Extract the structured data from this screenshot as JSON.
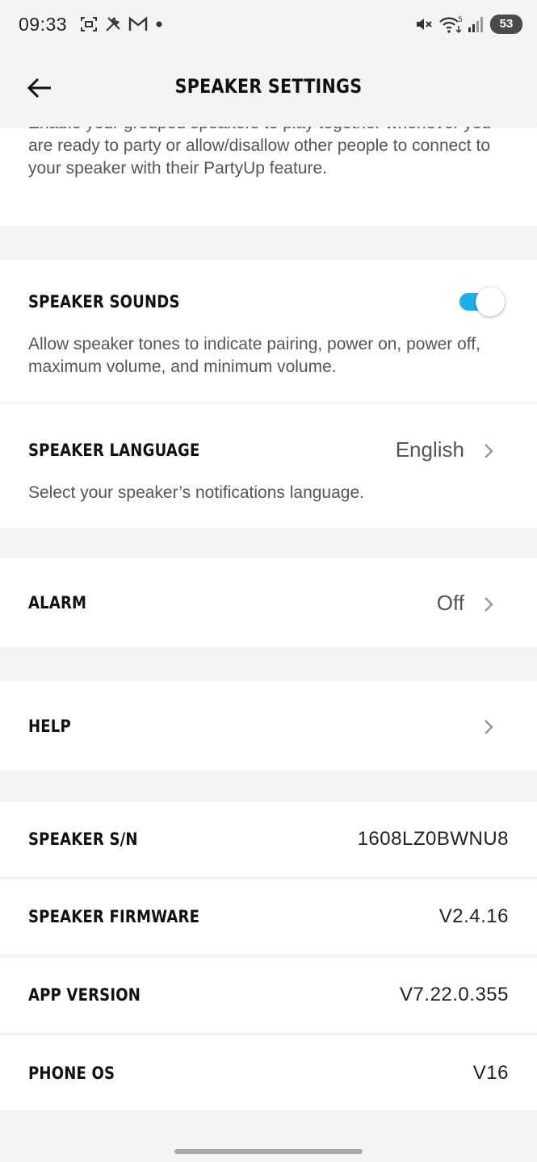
{
  "status_bar": {
    "time": "09:33",
    "battery": "53",
    "left_icons": [
      "screenshot-icon",
      "tools-icon",
      "gmail-icon",
      "notification-dot-icon"
    ],
    "right_icons": [
      "mute-icon",
      "wifi-icon",
      "signal-icon"
    ]
  },
  "header": {
    "title": "SPEAKER SETTINGS",
    "back_icon": "arrow-left-icon"
  },
  "partyup": {
    "description": "Enable your grouped speakers to play together whenever you are ready to party or allow/disallow other people to connect to your speaker with their PartyUp feature."
  },
  "speaker_sounds": {
    "title": "SPEAKER SOUNDS",
    "enabled": true,
    "description": "Allow speaker tones to indicate pairing, power on, power off, maximum volume, and minimum volume."
  },
  "speaker_language": {
    "title": "SPEAKER LANGUAGE",
    "value": "English",
    "description": "Select your speaker’s notifications language."
  },
  "alarm": {
    "title": "ALARM",
    "value": "Off"
  },
  "help": {
    "title": "HELP"
  },
  "info": [
    {
      "label": "SPEAKER S/N",
      "value": "1608LZ0BWNU8"
    },
    {
      "label": "SPEAKER FIRMWARE",
      "value": "V2.4.16"
    },
    {
      "label": "APP VERSION",
      "value": "V7.22.0.355"
    },
    {
      "label": "PHONE OS",
      "value": "V16"
    }
  ],
  "colors": {
    "accent": "#1ab0ea",
    "background": "#f4f4f4",
    "card": "#ffffff"
  }
}
